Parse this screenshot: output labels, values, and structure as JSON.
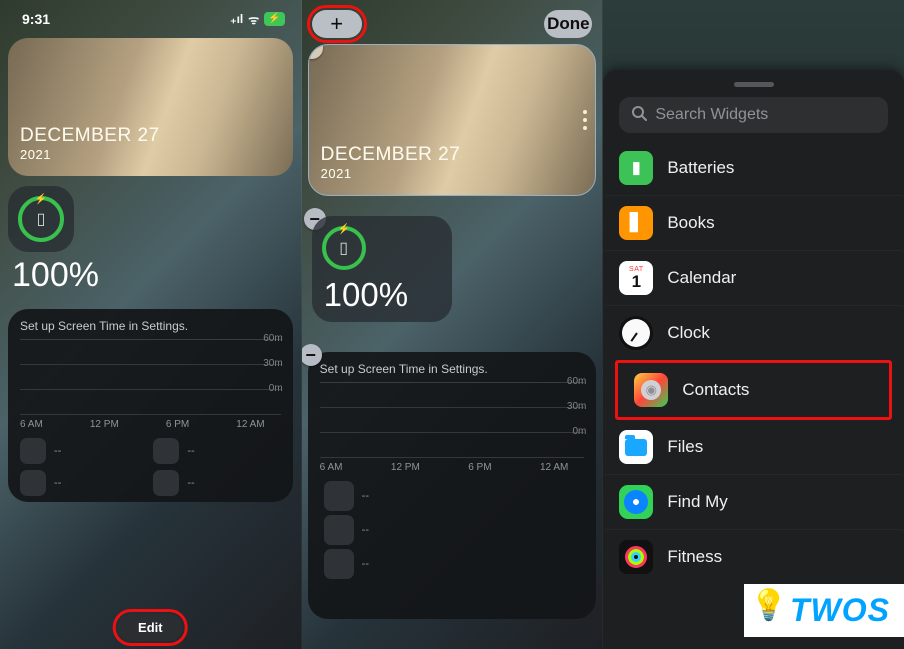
{
  "panel1": {
    "status": {
      "time": "9:31",
      "signal": "••",
      "wifi": "⦿",
      "battery": "⚡"
    },
    "photo": {
      "date": "DECEMBER 27",
      "year": "2021"
    },
    "battery": {
      "percent": "100%"
    },
    "screentime": {
      "title": "Set up Screen Time in Settings.",
      "ylabels": [
        "60m",
        "30m",
        "0m"
      ],
      "xlabels": [
        "6 AM",
        "12 PM",
        "6 PM",
        "12 AM"
      ],
      "placeholders": [
        "--",
        "--",
        "--",
        "--"
      ]
    },
    "edit_label": "Edit"
  },
  "panel2": {
    "add_label": "+",
    "done_label": "Done",
    "photo": {
      "date": "DECEMBER 27",
      "year": "2021"
    },
    "battery": {
      "percent": "100%"
    },
    "screentime": {
      "title": "Set up Screen Time in Settings.",
      "ylabels": [
        "60m",
        "30m",
        "0m"
      ],
      "xlabels": [
        "6 AM",
        "12 PM",
        "6 PM",
        "12 AM"
      ],
      "placeholders": [
        "--",
        "--",
        "--"
      ]
    }
  },
  "panel3": {
    "search_placeholder": "Search Widgets",
    "items": [
      {
        "label": "Batteries"
      },
      {
        "label": "Books"
      },
      {
        "label": "Calendar",
        "cal_day": "SAT",
        "cal_num": "1"
      },
      {
        "label": "Clock"
      },
      {
        "label": "Contacts"
      },
      {
        "label": "Files"
      },
      {
        "label": "Find My"
      },
      {
        "label": "Fitness"
      }
    ]
  },
  "watermark": {
    "text": "TWOS"
  },
  "chart_data": {
    "type": "bar",
    "title": "Set up Screen Time in Settings.",
    "categories": [
      "6 AM",
      "12 PM",
      "6 PM",
      "12 AM"
    ],
    "values": [
      0,
      0,
      0,
      0
    ],
    "ylabel": "minutes",
    "ylim": [
      0,
      60
    ],
    "yticks": [
      0,
      30,
      60
    ]
  }
}
